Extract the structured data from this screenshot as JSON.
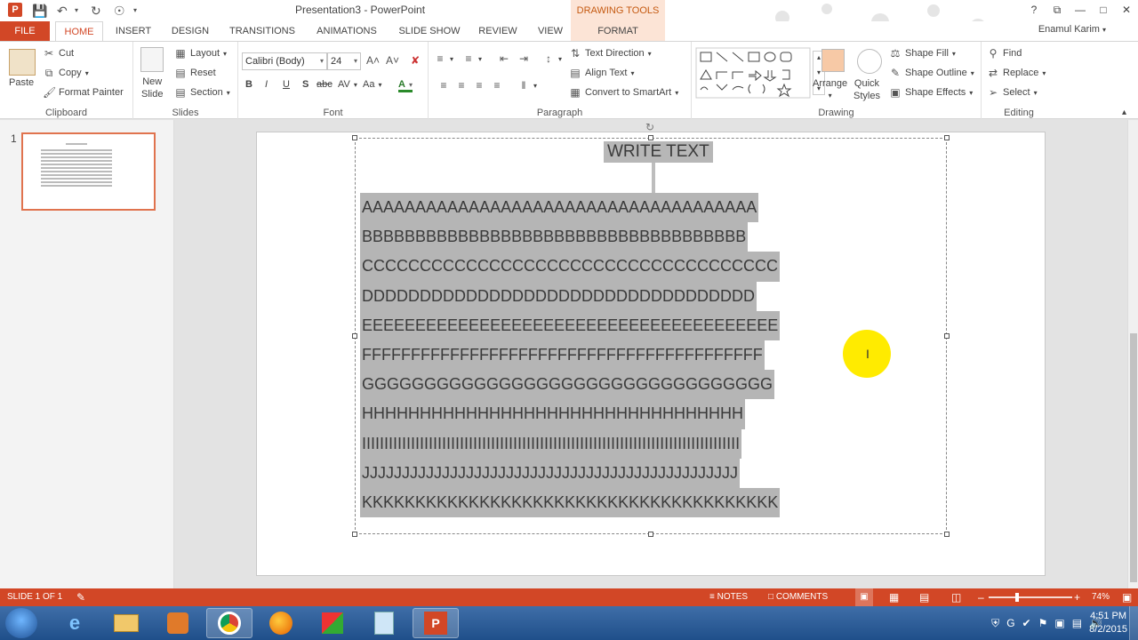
{
  "window": {
    "title": "Presentation3 - PowerPoint",
    "contextual_tab_group": "DRAWING TOOLS",
    "user": "Enamul Karim",
    "buttons": [
      "?",
      "⧉",
      "—",
      "□",
      "✕"
    ]
  },
  "tabs": [
    "FILE",
    "HOME",
    "INSERT",
    "DESIGN",
    "TRANSITIONS",
    "ANIMATIONS",
    "SLIDE SHOW",
    "REVIEW",
    "VIEW",
    "FORMAT"
  ],
  "ribbon": {
    "clipboard": {
      "label": "Clipboard",
      "paste": "Paste",
      "cut": "Cut",
      "copy": "Copy",
      "format_painter": "Format Painter"
    },
    "slides": {
      "label": "Slides",
      "new_slide_1": "New",
      "new_slide_2": "Slide",
      "layout": "Layout",
      "reset": "Reset",
      "section": "Section"
    },
    "font": {
      "label": "Font",
      "name": "Calibri (Body)",
      "size": "24",
      "bold": "B",
      "italic": "I",
      "underline": "U",
      "shadow": "S",
      "strike": "abc",
      "spacing": "AV",
      "case": "Aa",
      "color": "A"
    },
    "paragraph": {
      "label": "Paragraph",
      "text_direction": "Text Direction",
      "align_text": "Align Text",
      "convert_smartart": "Convert to SmartArt"
    },
    "drawing": {
      "label": "Drawing",
      "arrange": "Arrange",
      "quick_styles_1": "Quick",
      "quick_styles_2": "Styles",
      "shape_fill": "Shape Fill",
      "shape_outline": "Shape Outline",
      "shape_effects": "Shape Effects"
    },
    "editing": {
      "label": "Editing",
      "find": "Find",
      "replace": "Replace",
      "select": "Select"
    }
  },
  "thumbnails": {
    "slide_number": "1"
  },
  "slide": {
    "title": "WRITE TEXT",
    "lines": [
      "AAAAAAAAAAAAAAAAAAAAAAAAAAAAAAAAAAAAA",
      "BBBBBBBBBBBBBBBBBBBBBBBBBBBBBBBBBBBB",
      "CCCCCCCCCCCCCCCCCCCCCCCCCCCCCCCCCCCC",
      "DDDDDDDDDDDDDDDDDDDDDDDDDDDDDDDDDD",
      "EEEEEEEEEEEEEEEEEEEEEEEEEEEEEEEEEEEEEEE",
      "FFFFFFFFFFFFFFFFFFFFFFFFFFFFFFFFFFFFFFFFF",
      "GGGGGGGGGGGGGGGGGGGGGGGGGGGGGGGGG",
      "HHHHHHHHHHHHHHHHHHHHHHHHHHHHHHHHH",
      "IIIIIIIIIIIIIIIIIIIIIIIIIIIIIIIIIIIIIIIIIIIIIIIIIIIIIIIIIIIIIIIIIIIIIIIIIIIIIIIIIIIII",
      "JJJJJJJJJJJJJJJJJJJJJJJJJJJJJJJJJJJJJJJJJJJJJJJ",
      "KKKKKKKKKKKKKKKKKKKKKKKKKKKKKKKKKKKKKKK"
    ]
  },
  "statusbar": {
    "slide_info": "SLIDE 1 OF 1",
    "notes": "NOTES",
    "comments": "COMMENTS",
    "zoom": "74%"
  },
  "taskbar": {
    "time": "4:51 PM",
    "date": "8/2/2015"
  },
  "colors": {
    "accent": "#d24726",
    "selection_fill": "#b5b5b5",
    "pointer_highlight": "#ffeb00"
  }
}
